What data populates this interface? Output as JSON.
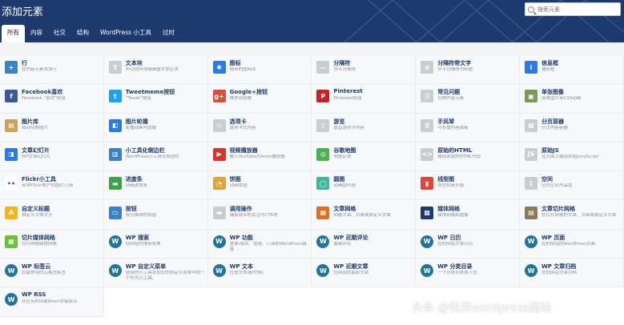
{
  "dialog": {
    "title": "添加元素",
    "search_placeholder": "搜索元素"
  },
  "tabs": [
    "所有",
    "内容",
    "社交",
    "结构",
    "WordPress 小工具",
    "过时"
  ],
  "elements": [
    {
      "name": "行",
      "desc": "在内容元素添加行",
      "icon": "plus-icon",
      "color": "#3b82c4"
    },
    {
      "name": "文本块",
      "desc": "所见即所得编辑器文本区块",
      "icon": "text-block-icon",
      "color": "#c9ccd1"
    },
    {
      "name": "图标",
      "desc": "随带的图标库",
      "icon": "gear-icon",
      "color": "#2c7be5"
    },
    {
      "name": "分隔符",
      "desc": "水平分隔线",
      "icon": "separator-icon",
      "color": "#c9ccd1"
    },
    {
      "name": "分隔符带文字",
      "desc": "水平分隔线与标题",
      "icon": "separator-text-icon",
      "color": "#c9ccd1"
    },
    {
      "name": "信息框",
      "desc": "通知框",
      "icon": "info-icon",
      "color": "#2c7be5"
    },
    {
      "name": "Facebook喜欢",
      "desc": "Facebook \"喜欢\"按钮",
      "icon": "facebook-icon",
      "color": "#3b5998"
    },
    {
      "name": "Tweetmeme按钮",
      "desc": "\"Tweet\"按钮",
      "icon": "twitter-icon",
      "color": "#1da1f2"
    },
    {
      "name": "Google+按钮",
      "desc": "推荐到谷歌",
      "icon": "google-plus-icon",
      "color": "#dd4b39"
    },
    {
      "name": "Pinterest",
      "desc": "Pinterest按钮",
      "icon": "pinterest-icon",
      "color": "#cb2027"
    },
    {
      "name": "常见问题",
      "desc": "切换内容元素",
      "icon": "faq-icon",
      "color": "#c9ccd1"
    },
    {
      "name": "单张图像",
      "desc": "简单图片带CSS动画",
      "icon": "image-icon",
      "color": "#7a9a5a"
    },
    {
      "name": "图片库",
      "desc": "自动切换图片",
      "icon": "gallery-icon",
      "color": "#c8a35a"
    },
    {
      "name": "图片轮播",
      "desc": "轮播动画与图像",
      "icon": "carousel-icon",
      "color": "#2c7be5"
    },
    {
      "name": "选项卡",
      "desc": "选项卡式内容",
      "icon": "tabs-icon",
      "color": "#c9ccd1"
    },
    {
      "name": "游览",
      "desc": "垂直选项卡内容",
      "icon": "tour-icon",
      "color": "#c9ccd1"
    },
    {
      "name": "手风琴",
      "desc": "可折叠内容面板",
      "icon": "accordion-icon",
      "color": "#c9ccd1"
    },
    {
      "name": "分页容器",
      "desc": "分页内容容器",
      "icon": "pageable-icon",
      "color": "#c9ccd1"
    },
    {
      "name": "文章幻灯片",
      "desc": "WP文章幻灯片",
      "icon": "slider-icon",
      "color": "#2c7be5"
    },
    {
      "name": "小工具化侧边栏",
      "desc": "WordPress小工具化侧边栏",
      "icon": "sidebar-icon",
      "color": "#3b82c4"
    },
    {
      "name": "视频播放器",
      "desc": "嵌入YouTube/Vimeo播放器",
      "icon": "video-icon",
      "color": "#d9342b"
    },
    {
      "name": "谷歌地图",
      "desc": "地图区块",
      "icon": "map-icon",
      "color": "#4caf50"
    },
    {
      "name": "原始的HTML",
      "desc": "输出原始的HTML代码",
      "icon": "html-icon",
      "color": "#c9ccd1"
    },
    {
      "name": "原始JS",
      "desc": "在页面上输出原始JavaScript",
      "icon": "js-icon",
      "color": "#c9ccd1"
    },
    {
      "name": "Flickr小工具",
      "desc": "来自Flickr帐户的图片订阅",
      "icon": "flickr-icon",
      "color": "#ffffff"
    },
    {
      "name": "进度条",
      "desc": "动画进度条",
      "icon": "progress-icon",
      "color": "#3fa14a"
    },
    {
      "name": "饼图",
      "desc": "动画饼图",
      "icon": "pie-icon",
      "color": "#e0a33a"
    },
    {
      "name": "圆图",
      "desc": "动画圆环图",
      "icon": "round-chart-icon",
      "color": "#3fb6a0"
    },
    {
      "name": "线型图",
      "desc": "线型和条形图",
      "icon": "line-chart-icon",
      "color": "#e0443a"
    },
    {
      "name": "空间",
      "desc": "空白空间与高度",
      "icon": "space-icon",
      "color": "#c9ccd1"
    },
    {
      "name": "自定义标题",
      "desc": "自定义字体文字",
      "icon": "heading-icon",
      "color": "#f0b51f"
    },
    {
      "name": "按钮",
      "desc": "吸引眼球的按钮",
      "icon": "button-icon",
      "color": "#3b82c4"
    },
    {
      "name": "调用操作",
      "desc": "捕捉观众的关注与CTA块",
      "icon": "cta-icon",
      "color": "#c9ccd1"
    },
    {
      "name": "文章网格",
      "desc": "网格文章、页面或自定义文章",
      "icon": "post-grid-icon",
      "color": "#e0701f"
    },
    {
      "name": "媒体网格",
      "desc": "媒体网格和图像",
      "icon": "media-grid-icon",
      "color": "#1d3a6e"
    },
    {
      "name": "文章切片网格",
      "desc": "在切片网格的文章、页面或自定义文章",
      "icon": "masonry-icon",
      "color": "#8a7a5a"
    },
    {
      "name": "切片媒体网格",
      "desc": "切片网格媒体网格",
      "icon": "masonry-media-icon",
      "color": "#6fbf3b"
    },
    {
      "name": "WP 搜索",
      "desc": "您网站的搜索表单",
      "icon": "wordpress-icon",
      "color": "#21759b"
    },
    {
      "name": "WP 功能",
      "desc": "登录/退出、管理、订阅和WordPress链接",
      "icon": "wordpress-icon",
      "color": "#21759b"
    },
    {
      "name": "WP 近期评论",
      "desc": "最新评论",
      "icon": "wordpress-icon",
      "color": "#21759b"
    },
    {
      "name": "WP 日历",
      "desc": "您的网站文章日历",
      "icon": "wordpress-icon",
      "color": "#21759b"
    },
    {
      "name": "WP 页面",
      "desc": "您的网站的WordPress页面",
      "icon": "wordpress-icon",
      "color": "#21759b"
    },
    {
      "name": "WP 标签云",
      "desc": "您最常用的云格式标签",
      "icon": "wordpress-icon",
      "color": "#21759b"
    },
    {
      "name": "WP 自定义菜单",
      "desc": "使用的小工具添加您的自定义菜单中的一个作为小工具。",
      "icon": "wordpress-icon",
      "color": "#21759b"
    },
    {
      "name": "WP 文本",
      "desc": "任意文本或HTML",
      "icon": "wordpress-icon",
      "color": "#21759b"
    },
    {
      "name": "WP 近期文章",
      "desc": "您网站的最新文章",
      "icon": "wordpress-icon",
      "color": "#21759b"
    },
    {
      "name": "WP 分类目录",
      "desc": "一个分类列表或下拉",
      "icon": "wordpress-icon",
      "color": "#21759b"
    },
    {
      "name": "WP 文章归档",
      "desc": "您的网站文章月档",
      "icon": "wordpress-icon",
      "color": "#21759b"
    },
    {
      "name": "WP RSS",
      "desc": "从任何RSS或Atom供稿条目",
      "icon": "wordpress-icon",
      "color": "#21759b"
    }
  ],
  "watermark": "头条 @悦然wordpress建站"
}
